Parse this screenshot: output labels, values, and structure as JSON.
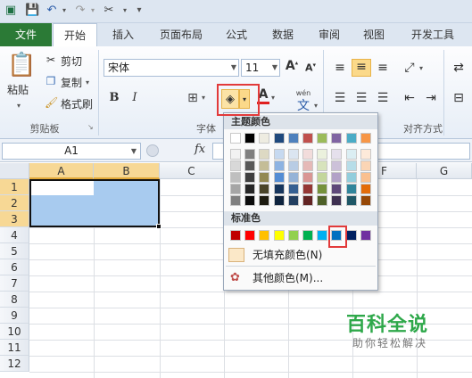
{
  "ribbon_tabs": [
    "文件",
    "开始",
    "插入",
    "页面布局",
    "公式",
    "数据",
    "审阅",
    "视图",
    "开发工具"
  ],
  "clipboard": {
    "paste": "粘贴",
    "cut": "剪切",
    "copy": "复制",
    "format_painter": "格式刷",
    "label": "剪贴板"
  },
  "font": {
    "name": "宋体",
    "size": "11",
    "bold": "B",
    "italic": "I",
    "font_color_glyph": "A",
    "label": "字体",
    "wen": "wén",
    "wen_char": "文"
  },
  "alignment": {
    "label": "对齐方式"
  },
  "formula_bar": {
    "cell_ref": "A1",
    "fx": "fx"
  },
  "columns": [
    "A",
    "B",
    "C",
    "D",
    "E",
    "F",
    "G"
  ],
  "rows": [
    "1",
    "2",
    "3",
    "4",
    "5",
    "6",
    "7",
    "8",
    "9",
    "10",
    "11",
    "12"
  ],
  "selection": {
    "range": "A1:B3",
    "fill_color": "#a8cbef"
  },
  "palette": {
    "theme_colors_label": "主题颜色",
    "standard_colors_label": "标准色",
    "no_fill": "无填充颜色(N)",
    "more_colors": "其他颜色(M)...",
    "theme_top": [
      "#ffffff",
      "#000000",
      "#eeece1",
      "#1f497d",
      "#4f81bd",
      "#c0504d",
      "#9bbb59",
      "#8064a2",
      "#4bacc6",
      "#f79646"
    ],
    "theme_shades": [
      [
        "#f2f2f2",
        "#7f7f7f",
        "#ddd9c3",
        "#c6d9f0",
        "#dbe5f1",
        "#f2dcdb",
        "#ebf1dd",
        "#e5e0ec",
        "#dbeef3",
        "#fdeada"
      ],
      [
        "#d8d8d8",
        "#595959",
        "#c4bd97",
        "#8db3e2",
        "#b8cce4",
        "#e5b9b7",
        "#d7e3bc",
        "#ccc1d9",
        "#b7dde8",
        "#fbd5b5"
      ],
      [
        "#bfbfbf",
        "#3f3f3f",
        "#938953",
        "#548dd4",
        "#95b3d7",
        "#d99694",
        "#c3d69b",
        "#b2a2c7",
        "#92cddc",
        "#fac08f"
      ],
      [
        "#a5a5a5",
        "#262626",
        "#494429",
        "#17365d",
        "#366092",
        "#953734",
        "#76923c",
        "#5f497a",
        "#31859b",
        "#e36c09"
      ],
      [
        "#7f7f7f",
        "#0c0c0c",
        "#1d1b10",
        "#0f243e",
        "#244061",
        "#632423",
        "#4f6128",
        "#3f3151",
        "#205867",
        "#974806"
      ]
    ],
    "standard": [
      "#c00000",
      "#ff0000",
      "#ffc000",
      "#ffff00",
      "#92d050",
      "#00b050",
      "#00b0f0",
      "#0070c0",
      "#002060",
      "#7030a0"
    ],
    "highlighted_standard": "#0070c0"
  },
  "watermark": {
    "title": "百科全说",
    "subtitle": "助你轻松解决"
  }
}
